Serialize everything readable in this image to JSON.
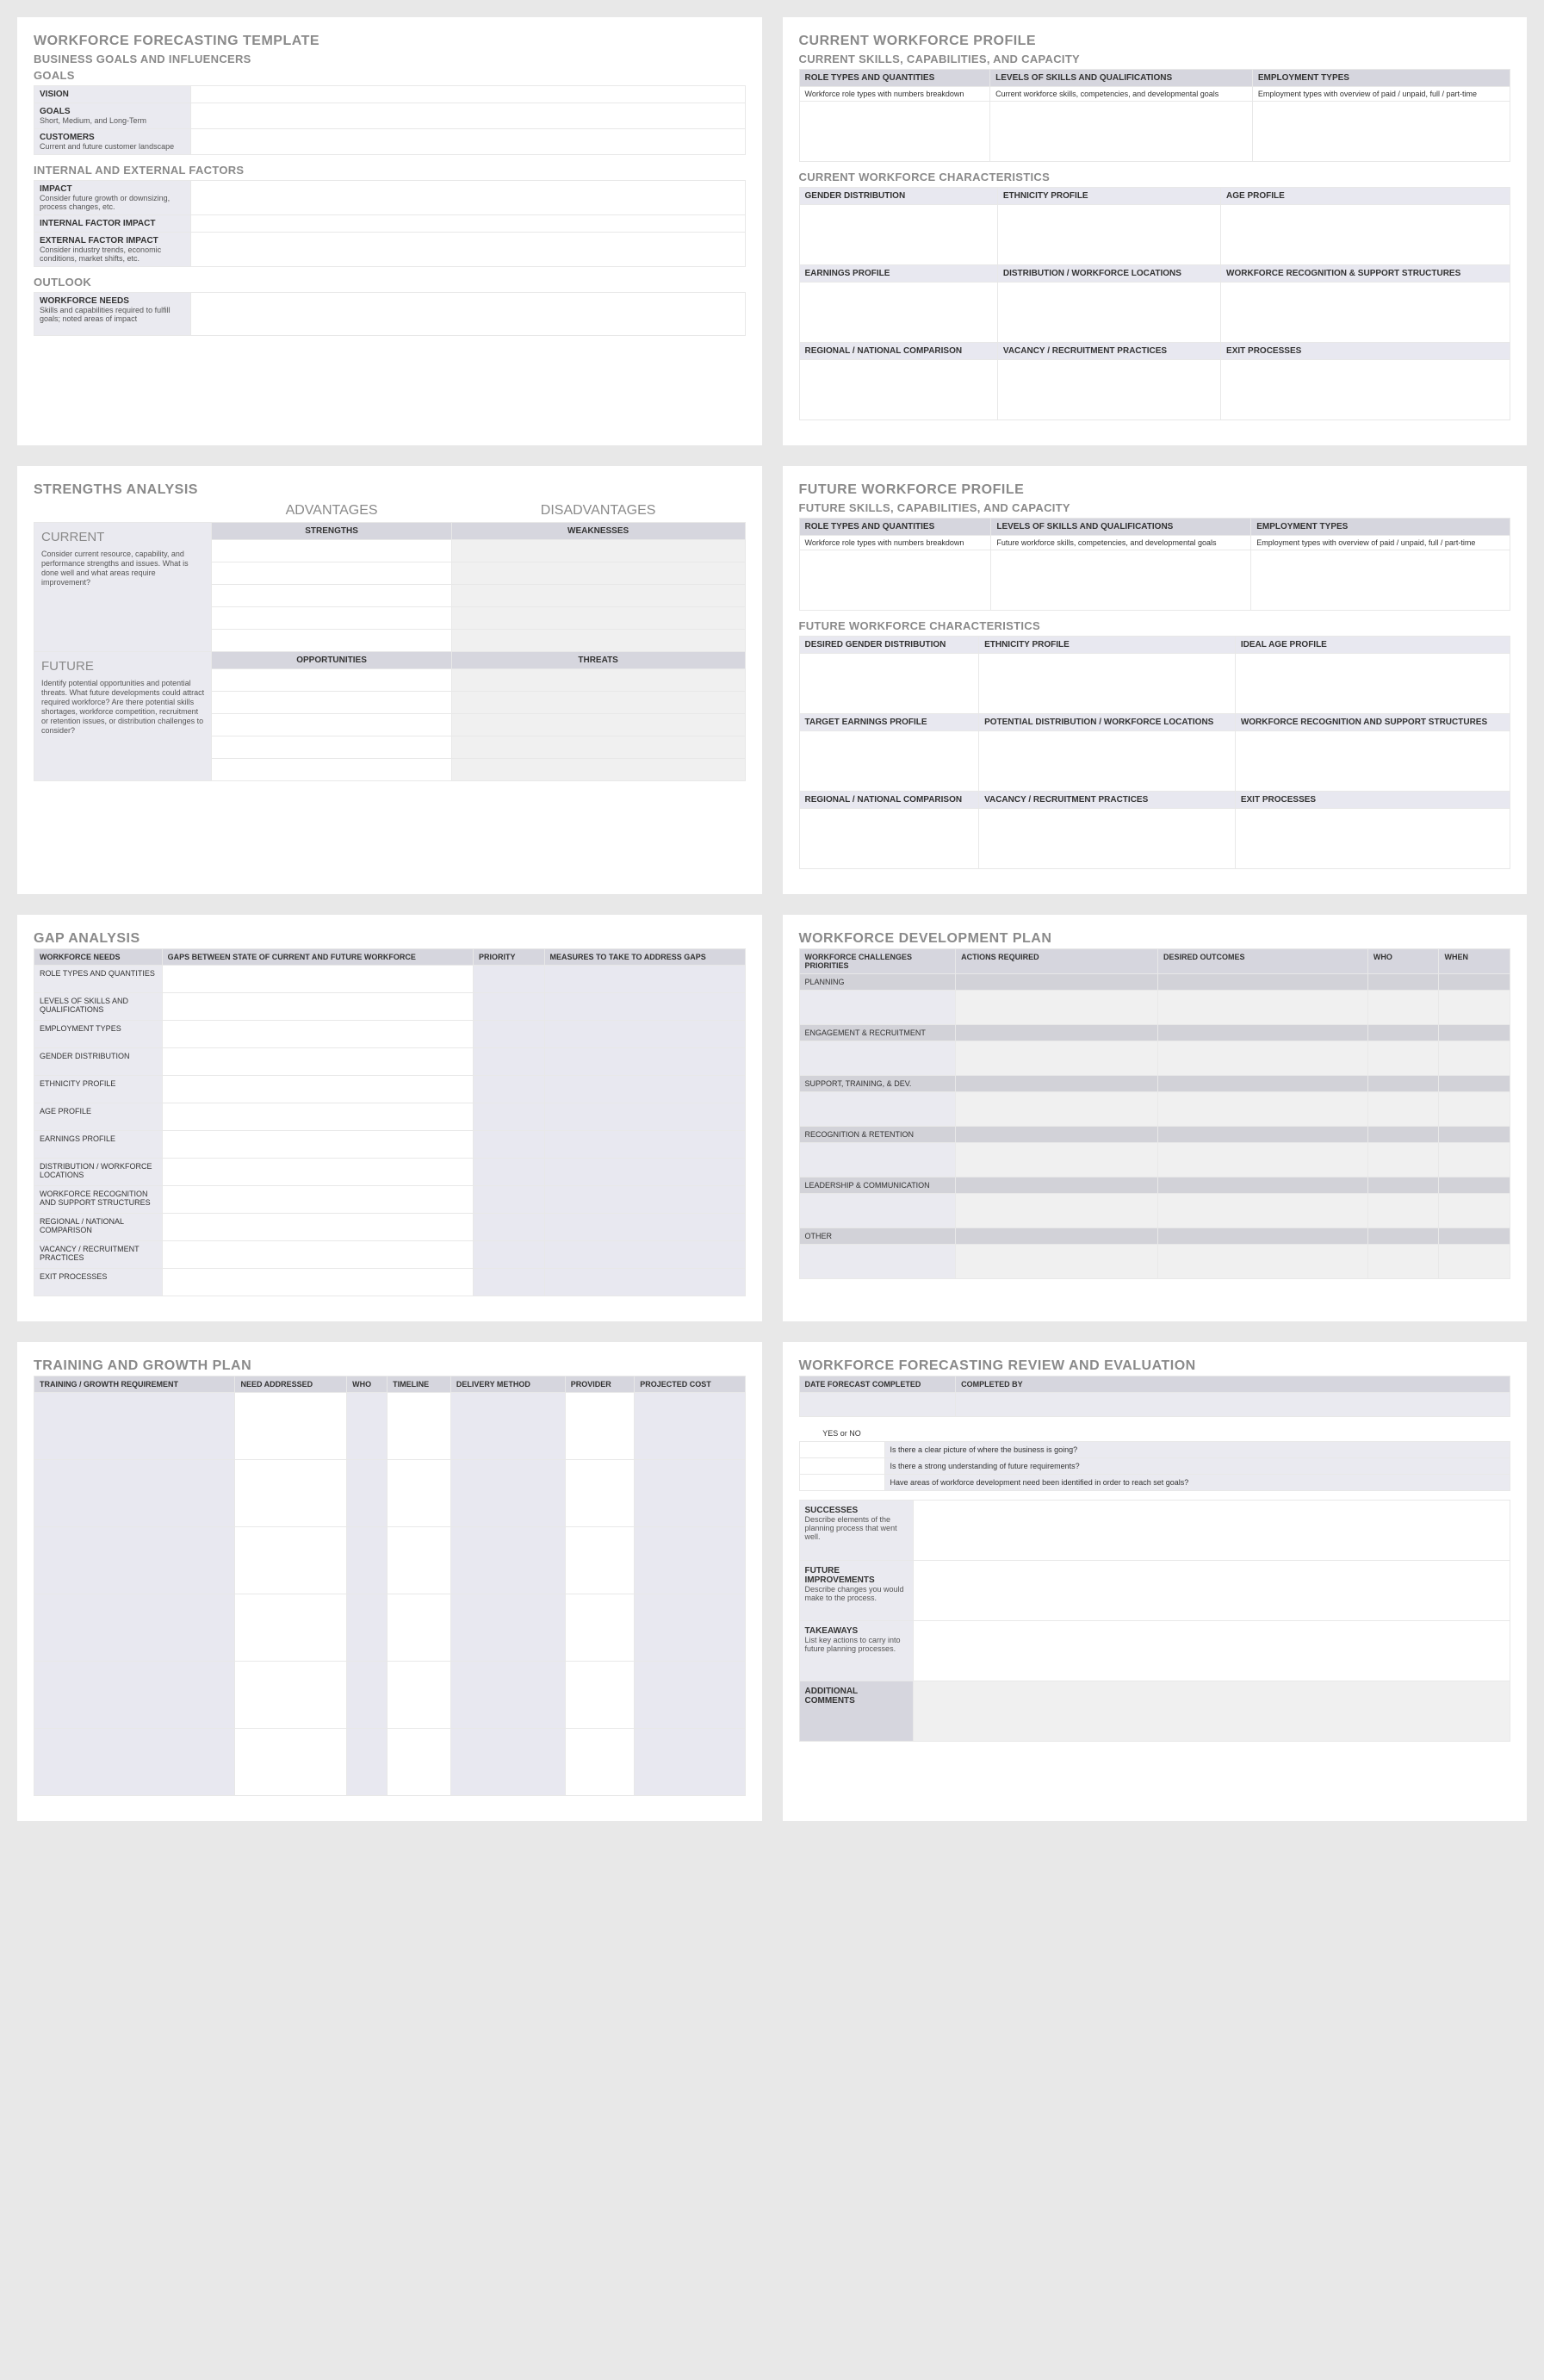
{
  "p1": {
    "title": "WORKFORCE FORECASTING TEMPLATE",
    "sub": "BUSINESS GOALS AND INFLUENCERS",
    "goals_h": "GOALS",
    "rows1": [
      {
        "t": "VISION",
        "s": ""
      },
      {
        "t": "GOALS",
        "s": "Short, Medium, and Long-Term"
      },
      {
        "t": "CUSTOMERS",
        "s": "Current and future customer landscape"
      }
    ],
    "factors_h": "INTERNAL AND EXTERNAL FACTORS",
    "rows2": [
      {
        "t": "IMPACT",
        "s": "Consider future growth or downsizing, process changes, etc."
      },
      {
        "t": "INTERNAL FACTOR IMPACT",
        "s": ""
      },
      {
        "t": "EXTERNAL FACTOR IMPACT",
        "s": "Consider industry trends, economic conditions, market shifts, etc."
      }
    ],
    "outlook_h": "OUTLOOK",
    "rows3": [
      {
        "t": "WORKFORCE NEEDS",
        "s": "Skills and capabilities required to fulfill goals; noted areas of impact"
      }
    ]
  },
  "p2": {
    "title": "CURRENT WORKFORCE PROFILE",
    "sub1": "CURRENT SKILLS, CAPABILITIES, AND CAPACITY",
    "h1": [
      "ROLE TYPES AND QUANTITIES",
      "LEVELS OF SKILLS AND QUALIFICATIONS",
      "EMPLOYMENT TYPES"
    ],
    "d1": [
      "Workforce role types with numbers breakdown",
      "Current workforce skills, competencies, and developmental goals",
      "Employment types with overview of paid / unpaid, full / part-time"
    ],
    "sub2": "CURRENT WORKFORCE CHARACTERISTICS",
    "grid": [
      [
        "GENDER DISTRIBUTION",
        "ETHNICITY PROFILE",
        "AGE PROFILE"
      ],
      [
        "EARNINGS PROFILE",
        "DISTRIBUTION / WORKFORCE LOCATIONS",
        "WORKFORCE RECOGNITION & SUPPORT STRUCTURES"
      ],
      [
        "REGIONAL / NATIONAL COMPARISON",
        "VACANCY / RECRUITMENT PRACTICES",
        "EXIT PROCESSES"
      ]
    ]
  },
  "p3": {
    "title": "STRENGTHS ANALYSIS",
    "adv": "ADVANTAGES",
    "dis": "DISADVANTAGES",
    "cur": "CURRENT",
    "cur_d": "Consider current resource, capability, and performance strengths and issues.  What is done well and what areas require improvement?",
    "fut": "FUTURE",
    "fut_d": "Identify potential opportunities and potential threats. What future developments could attract required workforce?  Are there potential skills shortages, workforce competition, recruitment or retention issues, or distribution challenges to consider?",
    "sw": [
      "STRENGTHS",
      "WEAKNESSES"
    ],
    "ot": [
      "OPPORTUNITIES",
      "THREATS"
    ]
  },
  "p4": {
    "title": "FUTURE WORKFORCE PROFILE",
    "sub1": "FUTURE SKILLS, CAPABILITIES, AND CAPACITY",
    "h1": [
      "ROLE TYPES AND QUANTITIES",
      "LEVELS OF SKILLS AND QUALIFICATIONS",
      "EMPLOYMENT TYPES"
    ],
    "d1": [
      "Workforce role types with numbers breakdown",
      "Future workforce skills, competencies, and developmental goals",
      "Employment types with overview of paid / unpaid, full / part-time"
    ],
    "sub2": "FUTURE WORKFORCE CHARACTERISTICS",
    "grid": [
      [
        "DESIRED GENDER DISTRIBUTION",
        "ETHNICITY PROFILE",
        "IDEAL AGE PROFILE"
      ],
      [
        "TARGET EARNINGS PROFILE",
        "POTENTIAL DISTRIBUTION / WORKFORCE LOCATIONS",
        "WORKFORCE RECOGNITION AND SUPPORT STRUCTURES"
      ],
      [
        "REGIONAL / NATIONAL COMPARISON",
        "VACANCY / RECRUITMENT PRACTICES",
        "EXIT PROCESSES"
      ]
    ]
  },
  "p5": {
    "title": "GAP ANALYSIS",
    "headers": [
      "WORKFORCE NEEDS",
      "GAPS BETWEEN STATE OF CURRENT AND FUTURE WORKFORCE",
      "PRIORITY",
      "MEASURES TO TAKE TO ADDRESS GAPS"
    ],
    "rows": [
      "ROLE TYPES AND QUANTITIES",
      "LEVELS OF SKILLS AND QUALIFICATIONS",
      "EMPLOYMENT TYPES",
      "GENDER DISTRIBUTION",
      "ETHNICITY PROFILE",
      "AGE PROFILE",
      "EARNINGS PROFILE",
      "DISTRIBUTION / WORKFORCE LOCATIONS",
      "WORKFORCE RECOGNITION AND SUPPORT STRUCTURES",
      "REGIONAL / NATIONAL COMPARISON",
      "VACANCY / RECRUITMENT PRACTICES",
      "EXIT PROCESSES"
    ]
  },
  "p6": {
    "title": "WORKFORCE DEVELOPMENT PLAN",
    "headers": [
      "WORKFORCE CHALLENGES PRIORITIES",
      "ACTIONS REQUIRED",
      "DESIRED OUTCOMES",
      "WHO",
      "WHEN"
    ],
    "cats": [
      "PLANNING",
      "ENGAGEMENT & RECRUITMENT",
      "SUPPORT, TRAINING, & DEV.",
      "RECOGNITION & RETENTION",
      "LEADERSHIP & COMMUNICATION",
      "OTHER"
    ]
  },
  "p7": {
    "title": "TRAINING AND GROWTH PLAN",
    "headers": [
      "TRAINING / GROWTH REQUIREMENT",
      "NEED ADDRESSED",
      "WHO",
      "TIMELINE",
      "DELIVERY METHOD",
      "PROVIDER",
      "PROJECTED COST"
    ]
  },
  "p8": {
    "title": "WORKFORCE FORECASTING REVIEW AND EVALUATION",
    "top": [
      "DATE FORECAST COMPLETED",
      "COMPLETED BY"
    ],
    "yn": "YES or NO",
    "qs": [
      "Is there a clear picture of where the business is going?",
      "Is there a strong understanding of future requirements?",
      "Have areas of workforce development need been identified in order to reach set goals?"
    ],
    "rows": [
      {
        "t": "SUCCESSES",
        "s": "Describe elements of the planning process that went well."
      },
      {
        "t": "FUTURE IMPROVEMENTS",
        "s": "Describe changes you would make to the process."
      },
      {
        "t": "TAKEAWAYS",
        "s": "List key actions to carry into future planning processes."
      }
    ],
    "addl": "ADDITIONAL COMMENTS"
  }
}
